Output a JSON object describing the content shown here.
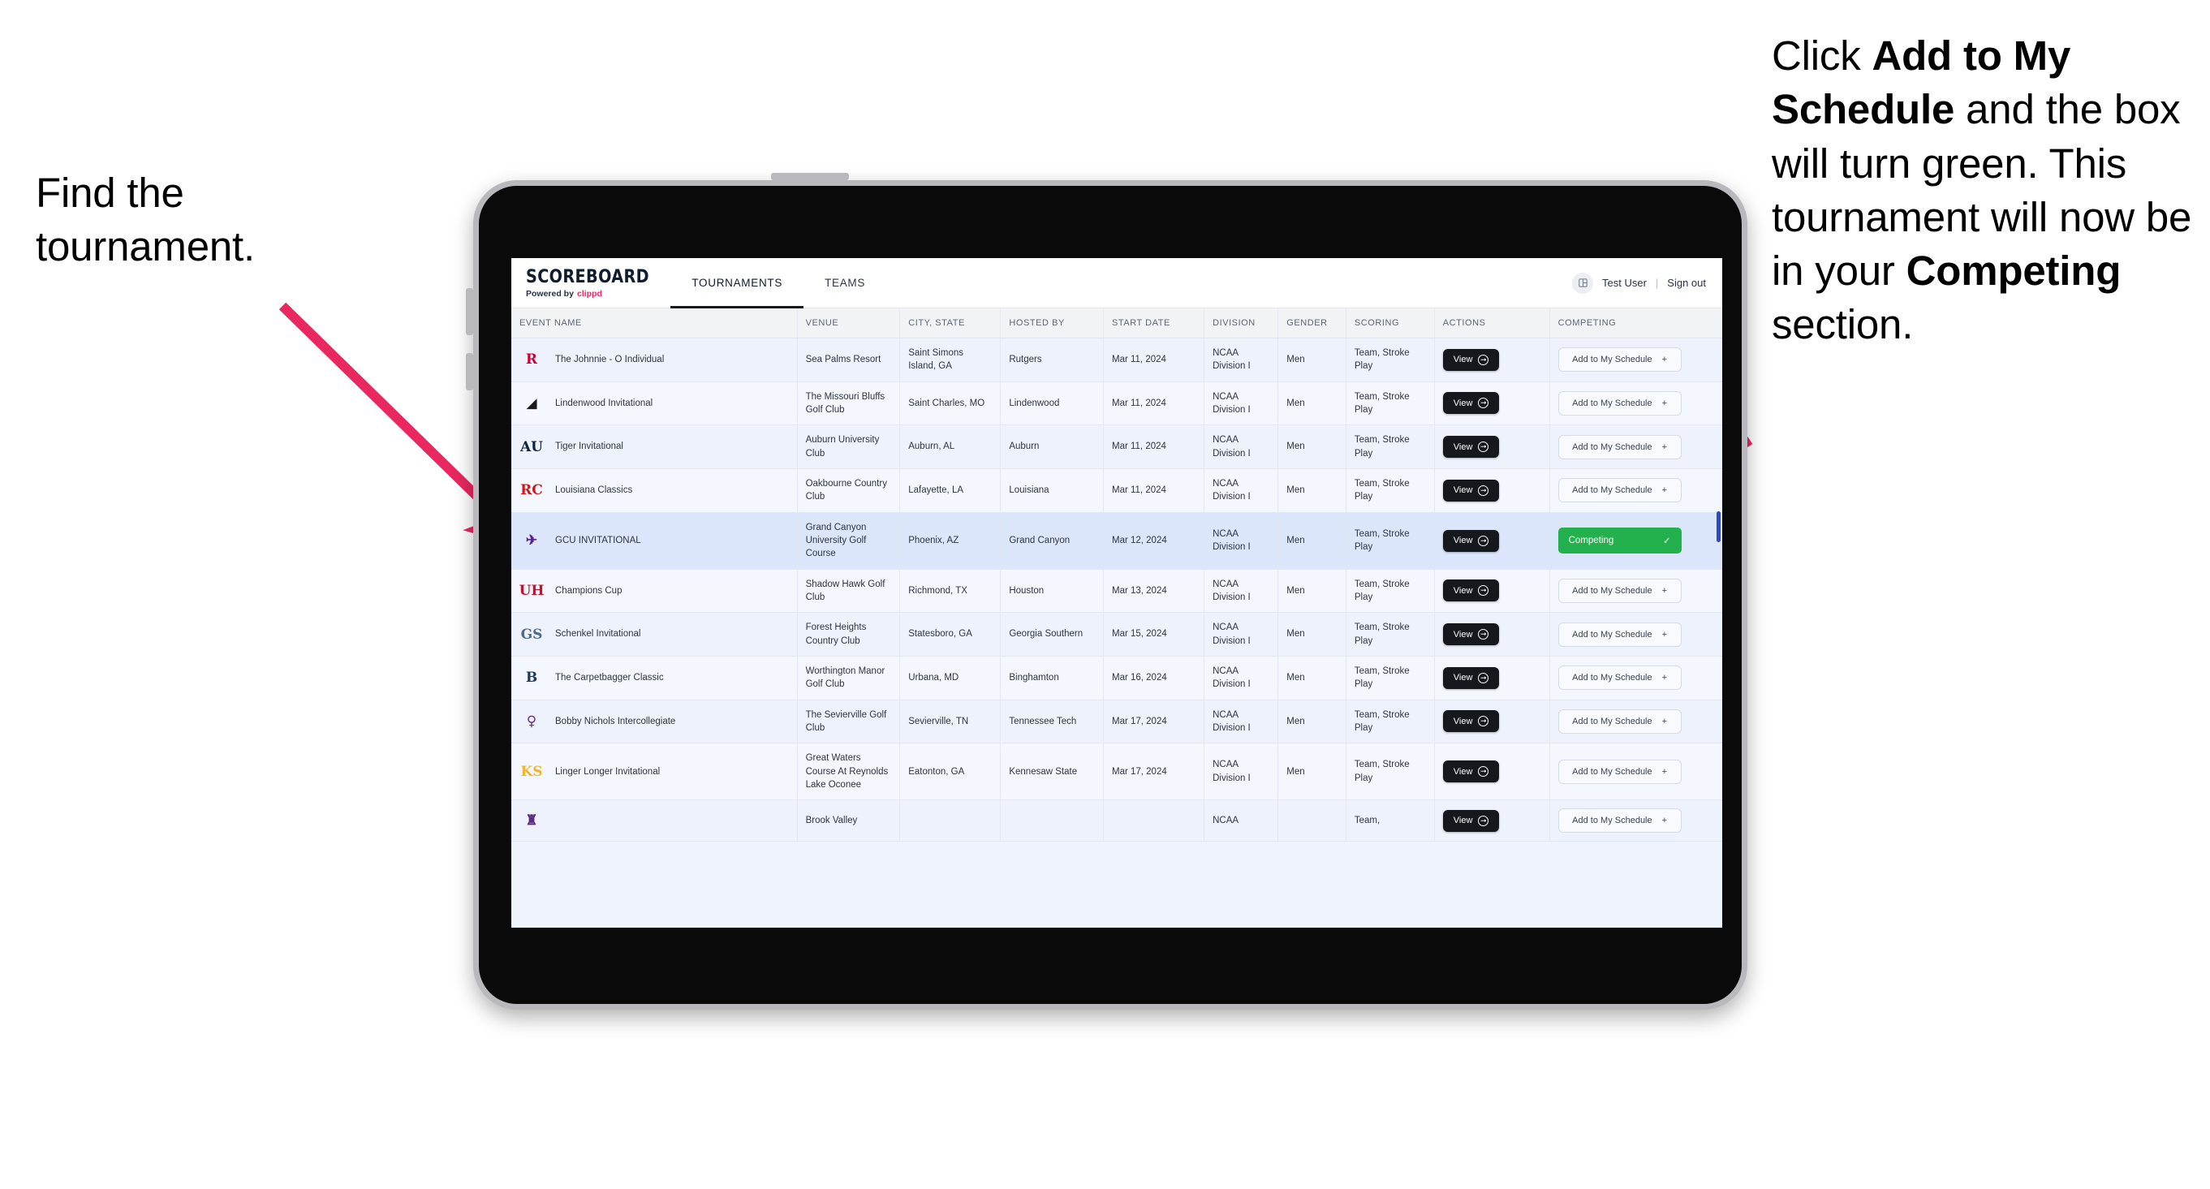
{
  "annotations": {
    "left": {
      "line1": "Find the",
      "line2": "tournament."
    },
    "right": {
      "seg1": "Click ",
      "bold1": "Add to My Schedule",
      "seg2": " and the box will turn green. This tournament will now be in your ",
      "bold2": "Competing",
      "seg3": " section."
    },
    "arrow_color": "#e8285f"
  },
  "app": {
    "brand": {
      "title": "SCOREBOARD",
      "powered_prefix": "Powered by",
      "powered_brand": "clippd",
      "brand_accent": "#ea2a5f"
    },
    "nav": [
      {
        "label": "TOURNAMENTS",
        "active": true
      },
      {
        "label": "TEAMS",
        "active": false
      }
    ],
    "user": {
      "avatar_icon": "user-avatar-icon",
      "name": "Test User",
      "separator": "|",
      "signout": "Sign out"
    },
    "table": {
      "columns": [
        "EVENT NAME",
        "VENUE",
        "CITY, STATE",
        "HOSTED BY",
        "START DATE",
        "DIVISION",
        "GENDER",
        "SCORING",
        "ACTIONS",
        "COMPETING"
      ],
      "view_label": "View",
      "view_icon": "arrow-right-circle-icon",
      "add_label": "Add to My Schedule",
      "add_icon": "plus-icon",
      "competing_label": "Competing",
      "competing_icon": "check-icon",
      "competing_color": "#22b14c",
      "rows": [
        {
          "logo": {
            "text": "R",
            "color": "#cc0033",
            "bg": "transparent"
          },
          "event": "The Johnnie - O Individual",
          "venue": "Sea Palms Resort",
          "city": "Saint Simons Island, GA",
          "host": "Rutgers",
          "date": "Mar 11, 2024",
          "division": "NCAA Division I",
          "gender": "Men",
          "scoring": "Team, Stroke Play",
          "competing": false
        },
        {
          "logo": {
            "text": "◢",
            "color": "#1b1b1b",
            "bg": "transparent"
          },
          "event": "Lindenwood Invitational",
          "venue": "The Missouri Bluffs Golf Club",
          "city": "Saint Charles, MO",
          "host": "Lindenwood",
          "date": "Mar 11, 2024",
          "division": "NCAA Division I",
          "gender": "Men",
          "scoring": "Team, Stroke Play",
          "competing": false
        },
        {
          "logo": {
            "text": "AU",
            "color": "#0c2340",
            "bg": "transparent"
          },
          "event": "Tiger Invitational",
          "venue": "Auburn University Club",
          "city": "Auburn, AL",
          "host": "Auburn",
          "date": "Mar 11, 2024",
          "division": "NCAA Division I",
          "gender": "Men",
          "scoring": "Team, Stroke Play",
          "competing": false
        },
        {
          "logo": {
            "text": "RC",
            "color": "#ce181e",
            "bg": "transparent"
          },
          "event": "Louisiana Classics",
          "venue": "Oakbourne Country Club",
          "city": "Lafayette, LA",
          "host": "Louisiana",
          "date": "Mar 11, 2024",
          "division": "NCAA Division I",
          "gender": "Men",
          "scoring": "Team, Stroke Play",
          "competing": false
        },
        {
          "logo": {
            "text": "✈",
            "color": "#522398",
            "bg": "transparent"
          },
          "event": "GCU INVITATIONAL",
          "venue": "Grand Canyon University Golf Course",
          "city": "Phoenix, AZ",
          "host": "Grand Canyon",
          "date": "Mar 12, 2024",
          "division": "NCAA Division I",
          "gender": "Men",
          "scoring": "Team, Stroke Play",
          "competing": true,
          "selected": true
        },
        {
          "logo": {
            "text": "UH",
            "color": "#c8102e",
            "bg": "transparent"
          },
          "event": "Champions Cup",
          "venue": "Shadow Hawk Golf Club",
          "city": "Richmond, TX",
          "host": "Houston",
          "date": "Mar 13, 2024",
          "division": "NCAA Division I",
          "gender": "Men",
          "scoring": "Team, Stroke Play",
          "competing": false
        },
        {
          "logo": {
            "text": "GS",
            "color": "#4a6b8a",
            "bg": "transparent"
          },
          "event": "Schenkel Invitational",
          "venue": "Forest Heights Country Club",
          "city": "Statesboro, GA",
          "host": "Georgia Southern",
          "date": "Mar 15, 2024",
          "division": "NCAA Division I",
          "gender": "Men",
          "scoring": "Team, Stroke Play",
          "competing": false
        },
        {
          "logo": {
            "text": "B",
            "color": "#1a3a5c",
            "bg": "transparent"
          },
          "event": "The Carpetbagger Classic",
          "venue": "Worthington Manor Golf Club",
          "city": "Urbana, MD",
          "host": "Binghamton",
          "date": "Mar 16, 2024",
          "division": "NCAA Division I",
          "gender": "Men",
          "scoring": "Team, Stroke Play",
          "competing": false
        },
        {
          "logo": {
            "text": "♀",
            "color": "#6a2c8f",
            "bg": "transparent"
          },
          "event": "Bobby Nichols Intercollegiate",
          "venue": "The Sevierville Golf Club",
          "city": "Sevierville, TN",
          "host": "Tennessee Tech",
          "date": "Mar 17, 2024",
          "division": "NCAA Division I",
          "gender": "Men",
          "scoring": "Team, Stroke Play",
          "competing": false
        },
        {
          "logo": {
            "text": "KS",
            "color": "#f1b434",
            "bg": "transparent"
          },
          "event": "Linger Longer Invitational",
          "venue": "Great Waters Course At Reynolds Lake Oconee",
          "city": "Eatonton, GA",
          "host": "Kennesaw State",
          "date": "Mar 17, 2024",
          "division": "NCAA Division I",
          "gender": "Men",
          "scoring": "Team, Stroke Play",
          "competing": false
        },
        {
          "logo": {
            "text": "♜",
            "color": "#5b2a86",
            "bg": "transparent"
          },
          "event": "",
          "venue": "Brook Valley",
          "city": "",
          "host": "",
          "date": "",
          "division": "NCAA",
          "gender": "",
          "scoring": "Team,",
          "competing": false,
          "clipped": true
        }
      ]
    }
  }
}
